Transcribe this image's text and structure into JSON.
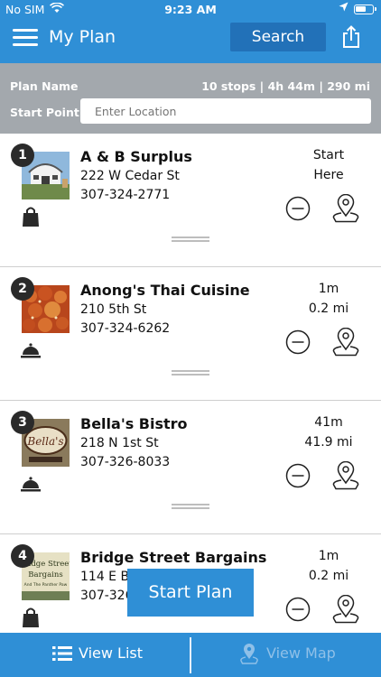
{
  "status": {
    "carrier": "No SIM",
    "time": "9:23 AM"
  },
  "header": {
    "title": "My Plan",
    "search_label": "Search"
  },
  "plan": {
    "name_label": "Plan Name",
    "stats": "10 stops | 4h 44m | 290 mi",
    "start_label": "Start Point",
    "location_placeholder": "Enter Location"
  },
  "stops": [
    {
      "num": "1",
      "name": "A & B Surplus",
      "address": "222 W Cedar St",
      "phone": "307-324-2771",
      "line1": "Start",
      "line2": "Here",
      "category_icon": "shopping-bag-icon"
    },
    {
      "num": "2",
      "name": "Anong's Thai Cuisine",
      "address": "210 5th St",
      "phone": "307-324-6262",
      "line1": "1m",
      "line2": "0.2 mi",
      "category_icon": "dining-cloche-icon"
    },
    {
      "num": "3",
      "name": "Bella's Bistro",
      "address": "218 N 1st St",
      "phone": "307-326-8033",
      "line1": "41m",
      "line2": "41.9 mi",
      "category_icon": "dining-cloche-icon"
    },
    {
      "num": "4",
      "name": "Bridge Street Bargains",
      "address": "114 E Br",
      "phone": "307-326",
      "line1": "1m",
      "line2": "0.2 mi",
      "category_icon": "shopping-bag-icon"
    }
  ],
  "thumbs": {
    "bella_sign": "Bella's",
    "bridge_sign_1": "Bridge Street",
    "bridge_sign_2": "Bargains",
    "bridge_sign_3": "And The Panther Paw"
  },
  "start_plan_label": "Start Plan",
  "bottom": {
    "list_label": "View List",
    "map_label": "View Map"
  },
  "colors": {
    "primary": "#2f8fd6",
    "search_button": "#2271b8",
    "plan_bar": "#a3a8ad"
  }
}
